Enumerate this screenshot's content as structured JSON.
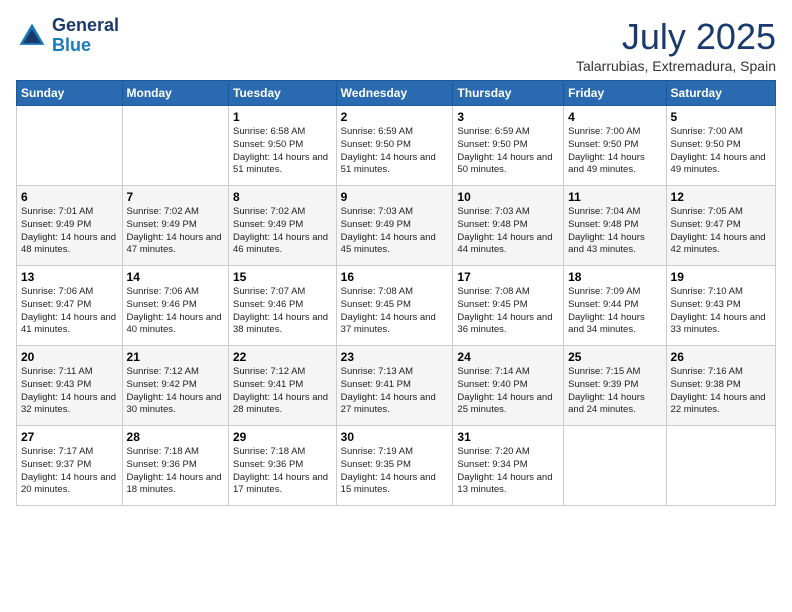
{
  "header": {
    "logo_line1": "General",
    "logo_line2": "Blue",
    "month": "July 2025",
    "location": "Talarrubias, Extremadura, Spain"
  },
  "weekdays": [
    "Sunday",
    "Monday",
    "Tuesday",
    "Wednesday",
    "Thursday",
    "Friday",
    "Saturday"
  ],
  "weeks": [
    [
      {
        "day": "",
        "content": ""
      },
      {
        "day": "",
        "content": ""
      },
      {
        "day": "1",
        "content": "Sunrise: 6:58 AM\nSunset: 9:50 PM\nDaylight: 14 hours and 51 minutes."
      },
      {
        "day": "2",
        "content": "Sunrise: 6:59 AM\nSunset: 9:50 PM\nDaylight: 14 hours and 51 minutes."
      },
      {
        "day": "3",
        "content": "Sunrise: 6:59 AM\nSunset: 9:50 PM\nDaylight: 14 hours and 50 minutes."
      },
      {
        "day": "4",
        "content": "Sunrise: 7:00 AM\nSunset: 9:50 PM\nDaylight: 14 hours and 49 minutes."
      },
      {
        "day": "5",
        "content": "Sunrise: 7:00 AM\nSunset: 9:50 PM\nDaylight: 14 hours and 49 minutes."
      }
    ],
    [
      {
        "day": "6",
        "content": "Sunrise: 7:01 AM\nSunset: 9:49 PM\nDaylight: 14 hours and 48 minutes."
      },
      {
        "day": "7",
        "content": "Sunrise: 7:02 AM\nSunset: 9:49 PM\nDaylight: 14 hours and 47 minutes."
      },
      {
        "day": "8",
        "content": "Sunrise: 7:02 AM\nSunset: 9:49 PM\nDaylight: 14 hours and 46 minutes."
      },
      {
        "day": "9",
        "content": "Sunrise: 7:03 AM\nSunset: 9:49 PM\nDaylight: 14 hours and 45 minutes."
      },
      {
        "day": "10",
        "content": "Sunrise: 7:03 AM\nSunset: 9:48 PM\nDaylight: 14 hours and 44 minutes."
      },
      {
        "day": "11",
        "content": "Sunrise: 7:04 AM\nSunset: 9:48 PM\nDaylight: 14 hours and 43 minutes."
      },
      {
        "day": "12",
        "content": "Sunrise: 7:05 AM\nSunset: 9:47 PM\nDaylight: 14 hours and 42 minutes."
      }
    ],
    [
      {
        "day": "13",
        "content": "Sunrise: 7:06 AM\nSunset: 9:47 PM\nDaylight: 14 hours and 41 minutes."
      },
      {
        "day": "14",
        "content": "Sunrise: 7:06 AM\nSunset: 9:46 PM\nDaylight: 14 hours and 40 minutes."
      },
      {
        "day": "15",
        "content": "Sunrise: 7:07 AM\nSunset: 9:46 PM\nDaylight: 14 hours and 38 minutes."
      },
      {
        "day": "16",
        "content": "Sunrise: 7:08 AM\nSunset: 9:45 PM\nDaylight: 14 hours and 37 minutes."
      },
      {
        "day": "17",
        "content": "Sunrise: 7:08 AM\nSunset: 9:45 PM\nDaylight: 14 hours and 36 minutes."
      },
      {
        "day": "18",
        "content": "Sunrise: 7:09 AM\nSunset: 9:44 PM\nDaylight: 14 hours and 34 minutes."
      },
      {
        "day": "19",
        "content": "Sunrise: 7:10 AM\nSunset: 9:43 PM\nDaylight: 14 hours and 33 minutes."
      }
    ],
    [
      {
        "day": "20",
        "content": "Sunrise: 7:11 AM\nSunset: 9:43 PM\nDaylight: 14 hours and 32 minutes."
      },
      {
        "day": "21",
        "content": "Sunrise: 7:12 AM\nSunset: 9:42 PM\nDaylight: 14 hours and 30 minutes."
      },
      {
        "day": "22",
        "content": "Sunrise: 7:12 AM\nSunset: 9:41 PM\nDaylight: 14 hours and 28 minutes."
      },
      {
        "day": "23",
        "content": "Sunrise: 7:13 AM\nSunset: 9:41 PM\nDaylight: 14 hours and 27 minutes."
      },
      {
        "day": "24",
        "content": "Sunrise: 7:14 AM\nSunset: 9:40 PM\nDaylight: 14 hours and 25 minutes."
      },
      {
        "day": "25",
        "content": "Sunrise: 7:15 AM\nSunset: 9:39 PM\nDaylight: 14 hours and 24 minutes."
      },
      {
        "day": "26",
        "content": "Sunrise: 7:16 AM\nSunset: 9:38 PM\nDaylight: 14 hours and 22 minutes."
      }
    ],
    [
      {
        "day": "27",
        "content": "Sunrise: 7:17 AM\nSunset: 9:37 PM\nDaylight: 14 hours and 20 minutes."
      },
      {
        "day": "28",
        "content": "Sunrise: 7:18 AM\nSunset: 9:36 PM\nDaylight: 14 hours and 18 minutes."
      },
      {
        "day": "29",
        "content": "Sunrise: 7:18 AM\nSunset: 9:36 PM\nDaylight: 14 hours and 17 minutes."
      },
      {
        "day": "30",
        "content": "Sunrise: 7:19 AM\nSunset: 9:35 PM\nDaylight: 14 hours and 15 minutes."
      },
      {
        "day": "31",
        "content": "Sunrise: 7:20 AM\nSunset: 9:34 PM\nDaylight: 14 hours and 13 minutes."
      },
      {
        "day": "",
        "content": ""
      },
      {
        "day": "",
        "content": ""
      }
    ]
  ]
}
